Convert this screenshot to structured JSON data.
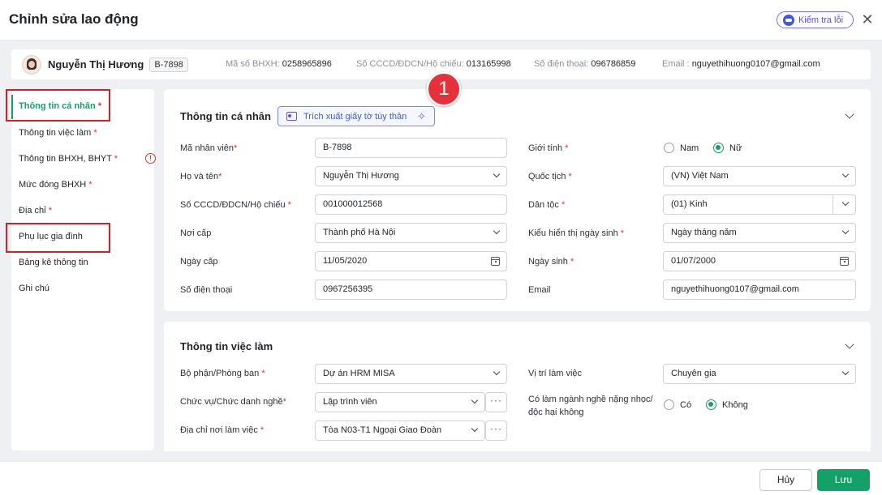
{
  "header": {
    "title": "Chỉnh sửa lao động",
    "check_button": "Kiểm tra lỗi"
  },
  "employee": {
    "name": "Nguyễn Thị Hương",
    "code": "B-7898",
    "bhxh_label": "Mã số BHXH:",
    "bhxh_value": "0258965896",
    "id_label": "Số CCCD/ĐDCN/Hộ chiếu:",
    "id_value": "013165998",
    "phone_label": "Số điện thoại:",
    "phone_value": "096786859",
    "email_label": "Email :",
    "email_value": "nguyethihuong0107@gmail.com"
  },
  "sidebar": {
    "items": [
      {
        "label": "Thông tin cá nhân",
        "required": "*"
      },
      {
        "label": "Thông tin việc làm",
        "required": "*"
      },
      {
        "label": "Thông tin BHXH, BHYT",
        "required": "*"
      },
      {
        "label": "Mức đóng BHXH",
        "required": "*"
      },
      {
        "label": "Địa chỉ",
        "required": "*"
      },
      {
        "label": "Phụ lục gia đình",
        "required": ""
      },
      {
        "label": "Bảng kê thông tin",
        "required": ""
      },
      {
        "label": "Ghi chú",
        "required": ""
      }
    ],
    "warning_glyph": "!"
  },
  "personal": {
    "title": "Thông tin cá nhân",
    "extract_button": "Trích xuất giấy tờ tùy thân",
    "marker": "1",
    "fields": {
      "emp_code": {
        "label": "Mã nhân viên",
        "value": "B-7898"
      },
      "full_name": {
        "label": "Họ và tên",
        "value": "Nguyễn Thị Hương"
      },
      "id_number": {
        "label": "Số CCCD/ĐDCN/Hộ chiếu",
        "value": "001000012568"
      },
      "issue_place": {
        "label": "Nơi cấp",
        "value": "Thành phố Hà Nội"
      },
      "issue_date": {
        "label": "Ngày cấp",
        "value": "11/05/2020"
      },
      "phone": {
        "label": "Số điện thoại",
        "value": "0967256395"
      },
      "gender": {
        "label": "Giới tính",
        "options": [
          "Nam",
          "Nữ"
        ],
        "selected": "Nữ"
      },
      "nationality": {
        "label": "Quốc tịch",
        "value": "(VN) Việt Nam"
      },
      "ethnicity": {
        "label": "Dân tộc",
        "value": "(01) Kinh"
      },
      "dob_format": {
        "label": "Kiểu hiển thị ngày sinh",
        "value": "Ngày tháng năm"
      },
      "dob": {
        "label": "Ngày sinh",
        "value": "01/07/2000"
      },
      "email": {
        "label": "Email",
        "value": "nguyethihuong0107@gmail.com"
      }
    }
  },
  "job": {
    "title": "Thông tin việc làm",
    "fields": {
      "department": {
        "label": "Bộ phận/Phòng ban",
        "value": "Dự án HRM MISA"
      },
      "position": {
        "label": "Chức vụ/Chức danh nghề",
        "value": "Lập trình viên"
      },
      "workplace": {
        "label": "Địa chỉ nơi làm việc",
        "value": "Tòa N03-T1 Ngoại Giao Đoàn"
      },
      "role": {
        "label": "Vị trí làm việc",
        "value": "Chuyên gia"
      },
      "hazardous": {
        "label_line1": "Có làm ngành nghề nặng nhọc/",
        "label_line2": "độc hại không",
        "options": [
          "Có",
          "Không"
        ],
        "selected": "Không"
      }
    }
  },
  "footer": {
    "cancel": "Hủy",
    "save": "Lưu"
  },
  "colors": {
    "accent": "#12a166",
    "highlight": "#d51f24",
    "required": "#e03131"
  },
  "icons": {
    "close": "close-icon",
    "calendar": "calendar-icon",
    "sparkle": "sparkle-icon",
    "id_card": "id-card-icon"
  }
}
